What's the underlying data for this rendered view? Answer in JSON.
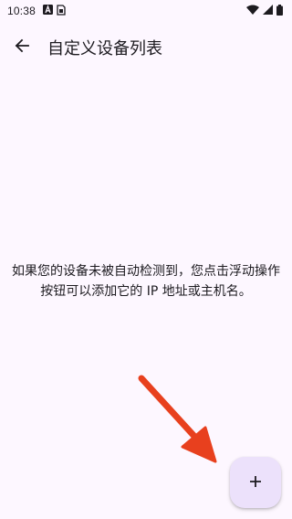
{
  "status_bar": {
    "time": "10:38",
    "left_icons": [
      "accessibility-a-icon",
      "sim-card-icon"
    ],
    "right_icons": [
      "wifi-icon",
      "signal-icon",
      "battery-icon"
    ]
  },
  "app_bar": {
    "back_icon": "arrow-back-icon",
    "title": "自定义设备列表"
  },
  "empty_state": {
    "message": "如果您的设备未被自动检测到，您点击浮动操作按钮可以添加它的 IP 地址或主机名。"
  },
  "fab": {
    "icon": "add-icon",
    "label": "+"
  },
  "colors": {
    "background": "#fdf7ff",
    "fab_background": "#ece1fb",
    "arrow": "#e8401e",
    "text": "#1d1b20"
  }
}
